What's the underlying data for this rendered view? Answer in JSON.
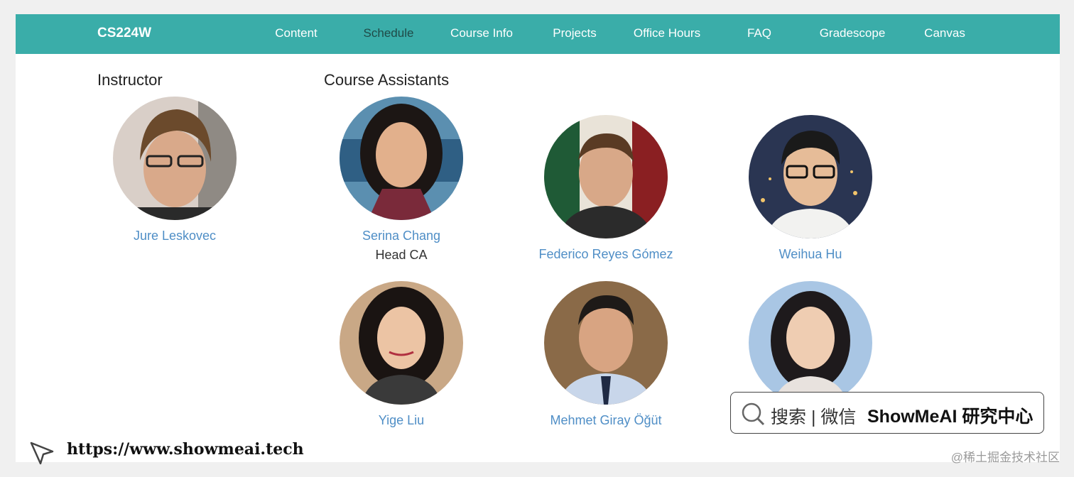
{
  "nav": {
    "brand": "CS224W",
    "items": [
      "Content",
      "Schedule",
      "Course Info",
      "Projects",
      "Office Hours",
      "FAQ",
      "Gradescope",
      "Canvas"
    ],
    "active": "Schedule",
    "color": "#3aada9"
  },
  "instructor": {
    "heading": "Instructor",
    "people": [
      {
        "name": "Jure Leskovec"
      }
    ]
  },
  "assistants": {
    "heading": "Course Assistants",
    "people": [
      {
        "name": "Serina Chang",
        "role": "Head CA"
      },
      {
        "name": "Federico Reyes Gómez"
      },
      {
        "name": "Weihua Hu"
      },
      {
        "name": "Yige Liu"
      },
      {
        "name": "Mehmet Giray Öğüt"
      },
      {
        "name": ""
      }
    ]
  },
  "overlay": {
    "search_label": "搜索 | 微信",
    "search_brand": "ShowMeAI 研究中心",
    "url": "https://www.showmeai.tech",
    "watermark": "@稀土掘金技术社区"
  },
  "colors": {
    "link": "#4f8ec6",
    "nav_active": "#1f4a47"
  }
}
